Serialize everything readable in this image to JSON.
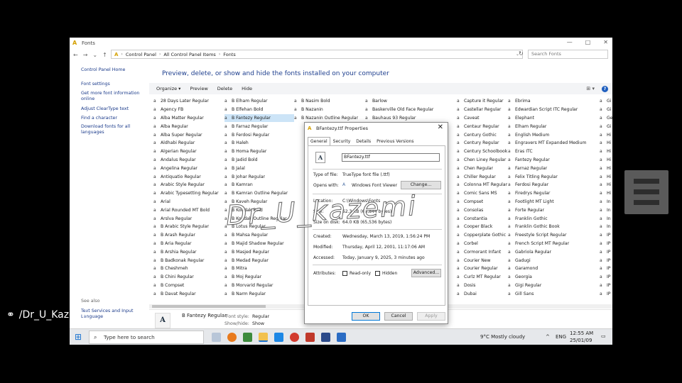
{
  "window": {
    "title": "Fonts",
    "controls": [
      "—",
      "□",
      "✕"
    ]
  },
  "address": {
    "crumbs": [
      "Control Panel",
      "All Control Panel Items",
      "Fonts"
    ],
    "search_placeholder": "Search Fonts"
  },
  "left_pane": {
    "home": "Control Panel Home",
    "links": [
      "Font settings",
      "Get more font information online",
      "Adjust ClearType text",
      "Find a character",
      "Download fonts for all languages"
    ],
    "see_also": "See also",
    "see_also_links": [
      "Text Services and Input Language"
    ]
  },
  "heading": "Preview, delete, or show and hide the fonts installed on your computer",
  "toolbar": {
    "organize": "Organize ▾",
    "preview": "Preview",
    "delete": "Delete",
    "hide": "Hide"
  },
  "columns": [
    [
      "28 Days Later Regular",
      "Agency FB",
      "Alba Matter Regular",
      "Alba Regular",
      "Alba Super Regular",
      "Aldhabi Regular",
      "Algerian Regular",
      "Andalus Regular",
      "Angelina Regular",
      "Antiquatio Regular",
      "Arabic Style Regular",
      "Arabic Typesetting Regular",
      "Arial",
      "Arial Rounded MT Bold",
      "Arslva Regular",
      "B Arabic Style Regular",
      "B Arash Regular",
      "B Aria Regular",
      "B Arshia Regular",
      "B Badkonak Regular",
      "B Cheshmeh",
      "B Chini Regular",
      "B Compset",
      "B Davat Regular"
    ],
    [
      "B Elham Regular",
      "B Elfehan Bold",
      "B Fantezy Regular",
      "B Farnaz Regular",
      "B Ferdosi Regular",
      "B Haleh",
      "B Homa Regular",
      "B Jadid Bold",
      "B Jalal",
      "B Johar Regular",
      "B Kamran",
      "B Kamran Outline Regular",
      "B Kaveh Regular",
      "B Koodak Bold",
      "B Koodak Outline Regular",
      "B Lotus Regular",
      "B Mahsa Regular",
      "B Majid Shadow Regular",
      "B Masjed Regular",
      "B Medad Regular",
      "B Mitra",
      "B Moj Regular",
      "B Morvarid Regular",
      "B Narm Regular"
    ],
    [
      "B Nasim Bold",
      "B Nazanin",
      "B Nazanin Outline Regular"
    ],
    [
      "Barlow",
      "Baskerville Old Face Regular",
      "Bauhaus 93 Regular"
    ],
    [
      "Capture it Regular",
      "Castellar Regular",
      "Caveat",
      "Centaur Regular",
      "Century Gothic",
      "Century Regular",
      "Century Schoolbook",
      "Chen Liney Regular",
      "Chen Regular",
      "Chiller Regular",
      "Colonna MT Regular",
      "Comic Sans MS",
      "Compset",
      "Consolas",
      "Constantia",
      "Cooper Black",
      "Copperplate Gothic",
      "Corbel",
      "Cormorant Infant",
      "Courier New",
      "Courier Regular",
      "Curlz MT Regular",
      "Dosis",
      "Dubai"
    ],
    [
      "Ebrima",
      "Edwardian Script ITC Regular",
      "Elephant",
      "Elham Regular",
      "English Medium",
      "Engravers MT Expanded Medium",
      "Eras ITC",
      "Fantezy Regular",
      "Farnaz Regular",
      "Felix Titling Regular",
      "Ferdosi Regular",
      "Firedrys Regular",
      "Footlight MT Light",
      "Forte Regular",
      "Franklin Gothic",
      "Franklin Gothic Book",
      "Freestyle Script Regular",
      "French Script MT Regular",
      "Gabriola Regular",
      "Gadugi",
      "Garamond",
      "Georgia",
      "Gigi Regular",
      "Gill Sans"
    ],
    [
      "Gi",
      "Gi",
      "Ge",
      "Gi",
      "Hi",
      "Hi",
      "Hi",
      "Hi",
      "Hi",
      "Hi",
      "Hi",
      "Hi",
      "In",
      "In",
      "In",
      "In",
      "IP",
      "IP",
      "IP",
      "IP",
      "IP",
      "IP",
      "IP",
      "IP"
    ]
  ],
  "selected_font": "B Fantezy Regular",
  "details": {
    "name": "B Fantezy Regular",
    "style_label": "Font style:",
    "style_value": "Regular",
    "showhide_label": "Show/hide:",
    "showhide_value": "Show"
  },
  "dialog": {
    "title": "BFantezy.ttf Properties",
    "tabs": [
      "General",
      "Security",
      "Details",
      "Previous Versions"
    ],
    "filename": "BFantezy.ttf",
    "props": [
      {
        "label": "Type of file:",
        "value": "TrueType font file (.ttf)"
      },
      {
        "label": "Opens with:",
        "value": "Windows Font Viewer"
      },
      {
        "label": "Location:",
        "value": "C:\\Windows\\Fonts"
      },
      {
        "label": "Size:",
        "value": "62.3 KB (63,844 bytes)"
      },
      {
        "label": "Size on disk:",
        "value": "64.0 KB (65,536 bytes)"
      },
      {
        "label": "Created:",
        "value": "Wednesday, March 13, 2019, 1:56:24 PM"
      },
      {
        "label": "Modified:",
        "value": "Thursday, April 12, 2001, 11:17:06 AM"
      },
      {
        "label": "Accessed:",
        "value": "Today, January 9, 2025, 3 minutes ago"
      }
    ],
    "change_btn": "Change...",
    "attributes_label": "Attributes:",
    "readonly": "Read-only",
    "hidden": "Hidden",
    "advanced_btn": "Advanced...",
    "ok": "OK",
    "cancel": "Cancel",
    "apply": "Apply"
  },
  "watermark": {
    "text": "Dr_U_kazemi",
    "channel": "/Dr_U_Kazemi"
  },
  "taskbar": {
    "search_placeholder": "Type here to search",
    "weather": "9°C  Mostly cloudy",
    "lang": "ENG",
    "time": "12:55 AM",
    "date": "25/01/09"
  }
}
